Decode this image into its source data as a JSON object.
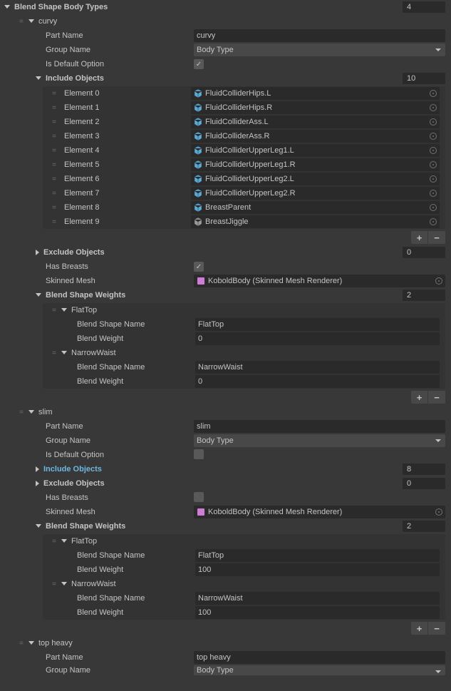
{
  "header": {
    "title": "Blend Shape Body Types",
    "count": "4"
  },
  "bodyTypes": [
    {
      "name": "curvy",
      "partNameLabel": "Part Name",
      "partName": "curvy",
      "groupNameLabel": "Group Name",
      "groupName": "Body Type",
      "isDefaultLabel": "Is Default Option",
      "isDefault": true,
      "includeLabel": "Include Objects",
      "includeCount": "10",
      "includeObjects": [
        {
          "label": "Element 0",
          "value": "FluidColliderHips.L",
          "icon": "cube"
        },
        {
          "label": "Element 1",
          "value": "FluidColliderHips.R",
          "icon": "cube"
        },
        {
          "label": "Element 2",
          "value": "FluidColliderAss.L",
          "icon": "cube"
        },
        {
          "label": "Element 3",
          "value": "FluidColliderAss.R",
          "icon": "cube"
        },
        {
          "label": "Element 4",
          "value": "FluidColliderUpperLeg1.L",
          "icon": "cube"
        },
        {
          "label": "Element 5",
          "value": "FluidColliderUpperLeg1.R",
          "icon": "cube"
        },
        {
          "label": "Element 6",
          "value": "FluidColliderUpperLeg2.L",
          "icon": "cube"
        },
        {
          "label": "Element 7",
          "value": "FluidColliderUpperLeg2.R",
          "icon": "cube"
        },
        {
          "label": "Element 8",
          "value": "BreastParent",
          "icon": "cube"
        },
        {
          "label": "Element 9",
          "value": "BreastJiggle",
          "icon": "cube-gray"
        }
      ],
      "excludeLabel": "Exclude Objects",
      "excludeCount": "0",
      "hasBreastsLabel": "Has Breasts",
      "hasBreasts": true,
      "skinnedMeshLabel": "Skinned Mesh",
      "skinnedMesh": "KoboldBody (Skinned Mesh Renderer)",
      "weightsLabel": "Blend Shape Weights",
      "weightsCount": "2",
      "weights": [
        {
          "header": "FlatTop",
          "nameLabel": "Blend Shape Name",
          "name": "FlatTop",
          "weightLabel": "Blend Weight",
          "weight": "0"
        },
        {
          "header": "NarrowWaist",
          "nameLabel": "Blend Shape Name",
          "name": "NarrowWaist",
          "weightLabel": "Blend Weight",
          "weight": "0"
        }
      ]
    },
    {
      "name": "slim",
      "partNameLabel": "Part Name",
      "partName": "slim",
      "groupNameLabel": "Group Name",
      "groupName": "Body Type",
      "isDefaultLabel": "Is Default Option",
      "isDefault": false,
      "includeLabel": "Include Objects",
      "includeCount": "8",
      "excludeLabel": "Exclude Objects",
      "excludeCount": "0",
      "hasBreastsLabel": "Has Breasts",
      "hasBreasts": false,
      "skinnedMeshLabel": "Skinned Mesh",
      "skinnedMesh": "KoboldBody (Skinned Mesh Renderer)",
      "weightsLabel": "Blend Shape Weights",
      "weightsCount": "2",
      "weights": [
        {
          "header": "FlatTop",
          "nameLabel": "Blend Shape Name",
          "name": "FlatTop",
          "weightLabel": "Blend Weight",
          "weight": "100"
        },
        {
          "header": "NarrowWaist",
          "nameLabel": "Blend Shape Name",
          "name": "NarrowWaist",
          "weightLabel": "Blend Weight",
          "weight": "100"
        }
      ]
    },
    {
      "name": "top heavy",
      "partNameLabel": "Part Name",
      "partName": "top heavy",
      "groupNameLabel": "Group Name",
      "groupName": "Body Type"
    }
  ],
  "buttons": {
    "plus": "+",
    "minus": "−"
  }
}
